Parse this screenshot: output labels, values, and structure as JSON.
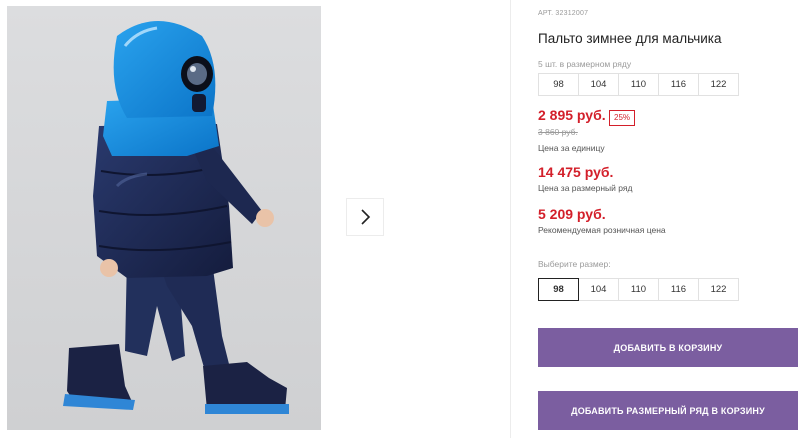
{
  "product": {
    "sku": "АРТ. 32312007",
    "title": "Пальто зимнее для мальчика",
    "size_row_note": "5 шт. в размерном ряду",
    "size_row": [
      "98",
      "104",
      "110",
      "116",
      "122"
    ]
  },
  "prices": {
    "unit_price": "2 895 руб.",
    "discount": "25%",
    "old_price": "3 860 руб.",
    "unit_label": "Цена за единицу",
    "row_price": "14 475 руб.",
    "row_label": "Цена за размерный ряд",
    "rrp_price": "5 209 руб.",
    "rrp_label": "Рекомендуемая розничная цена"
  },
  "size_select": {
    "label": "Выберите размер:",
    "options": [
      "98",
      "104",
      "110",
      "116",
      "122"
    ],
    "selected": "98"
  },
  "buttons": {
    "add_to_cart": "ДОБАВИТЬ В КОРЗИНУ",
    "add_row_to_cart": "ДОБАВИТЬ РАЗМЕРНЫЙ РЯД В КОРЗИНУ"
  },
  "gallery": {
    "next_icon": "chevron-right-icon"
  },
  "colors": {
    "accent_button": "#7b5ea0",
    "price_red": "#d31f2a",
    "photo_background": "#d7d8da"
  }
}
